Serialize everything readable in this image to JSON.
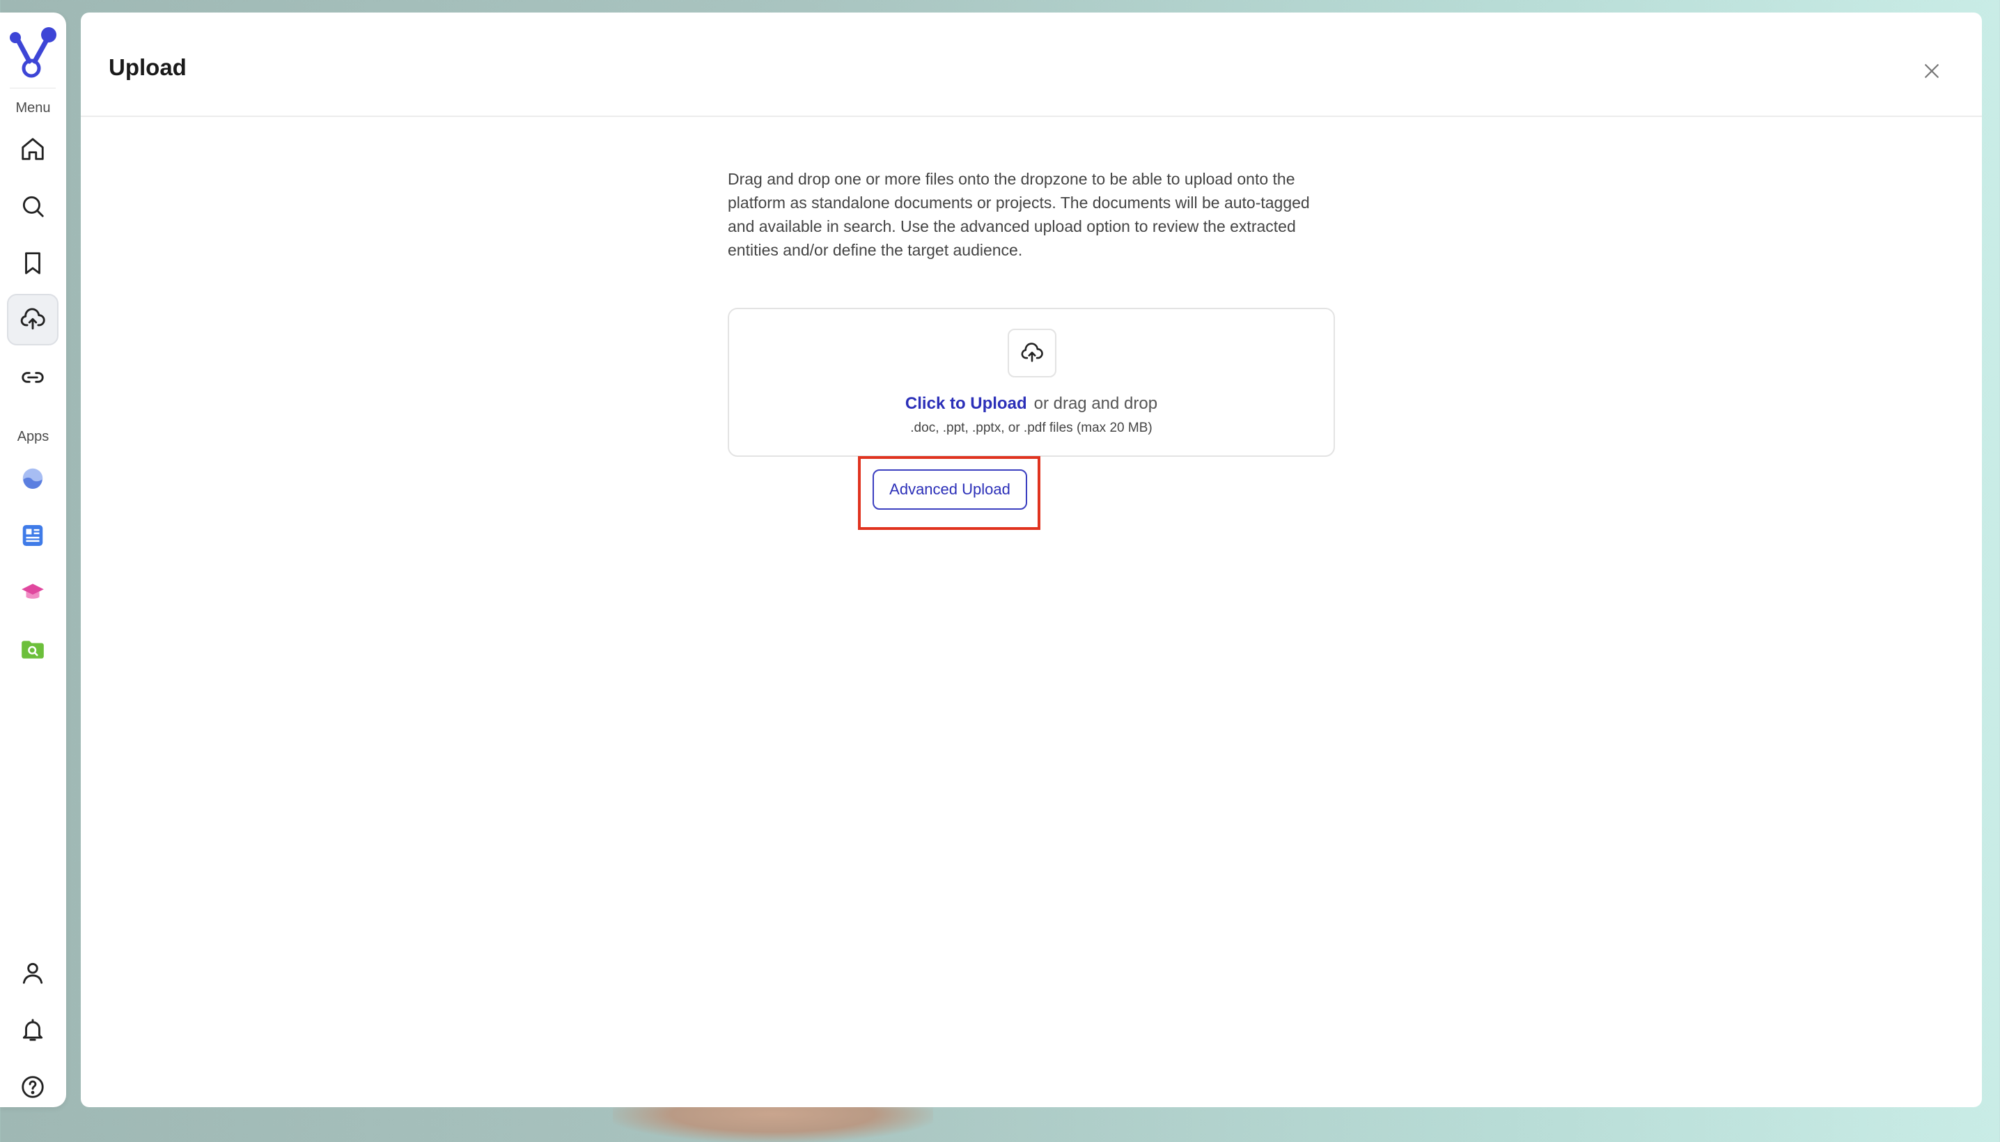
{
  "sidebar": {
    "menu_label": "Menu",
    "apps_label": "Apps",
    "menu_items": [
      {
        "name": "home",
        "icon": "home-icon"
      },
      {
        "name": "search",
        "icon": "search-icon"
      },
      {
        "name": "bookmarks",
        "icon": "bookmark-icon"
      },
      {
        "name": "upload",
        "icon": "cloud-upload-icon",
        "active": true
      },
      {
        "name": "links",
        "icon": "link-icon"
      }
    ],
    "app_items": [
      {
        "name": "app-1",
        "icon": "crescent-app-icon",
        "color": "#6b8ee8"
      },
      {
        "name": "app-2",
        "icon": "document-list-app-icon",
        "color": "#3f7be8"
      },
      {
        "name": "app-3",
        "icon": "graduation-cap-app-icon",
        "color": "#e0479e"
      },
      {
        "name": "app-4",
        "icon": "folder-search-app-icon",
        "color": "#6cbf3b"
      }
    ],
    "bottom_items": [
      {
        "name": "profile",
        "icon": "user-icon"
      },
      {
        "name": "notifications",
        "icon": "bell-icon"
      },
      {
        "name": "help",
        "icon": "help-icon"
      }
    ]
  },
  "panel": {
    "title": "Upload",
    "description": "Drag and drop one or more files onto the dropzone to be able to upload onto the platform as standalone documents or projects. The documents will be auto-tagged and available in search. Use the advanced upload option to review the extracted entities and/or define the target audience.",
    "dropzone": {
      "link_text": "Click to Upload",
      "rest_text": "or drag and drop",
      "hint": ".doc, .ppt, .pptx, or .pdf files (max 20 MB)"
    },
    "advanced_upload_label": "Advanced Upload"
  },
  "colors": {
    "accent": "#2b2fb8",
    "highlight": "#e0331f",
    "logo": "#3d45d6"
  }
}
